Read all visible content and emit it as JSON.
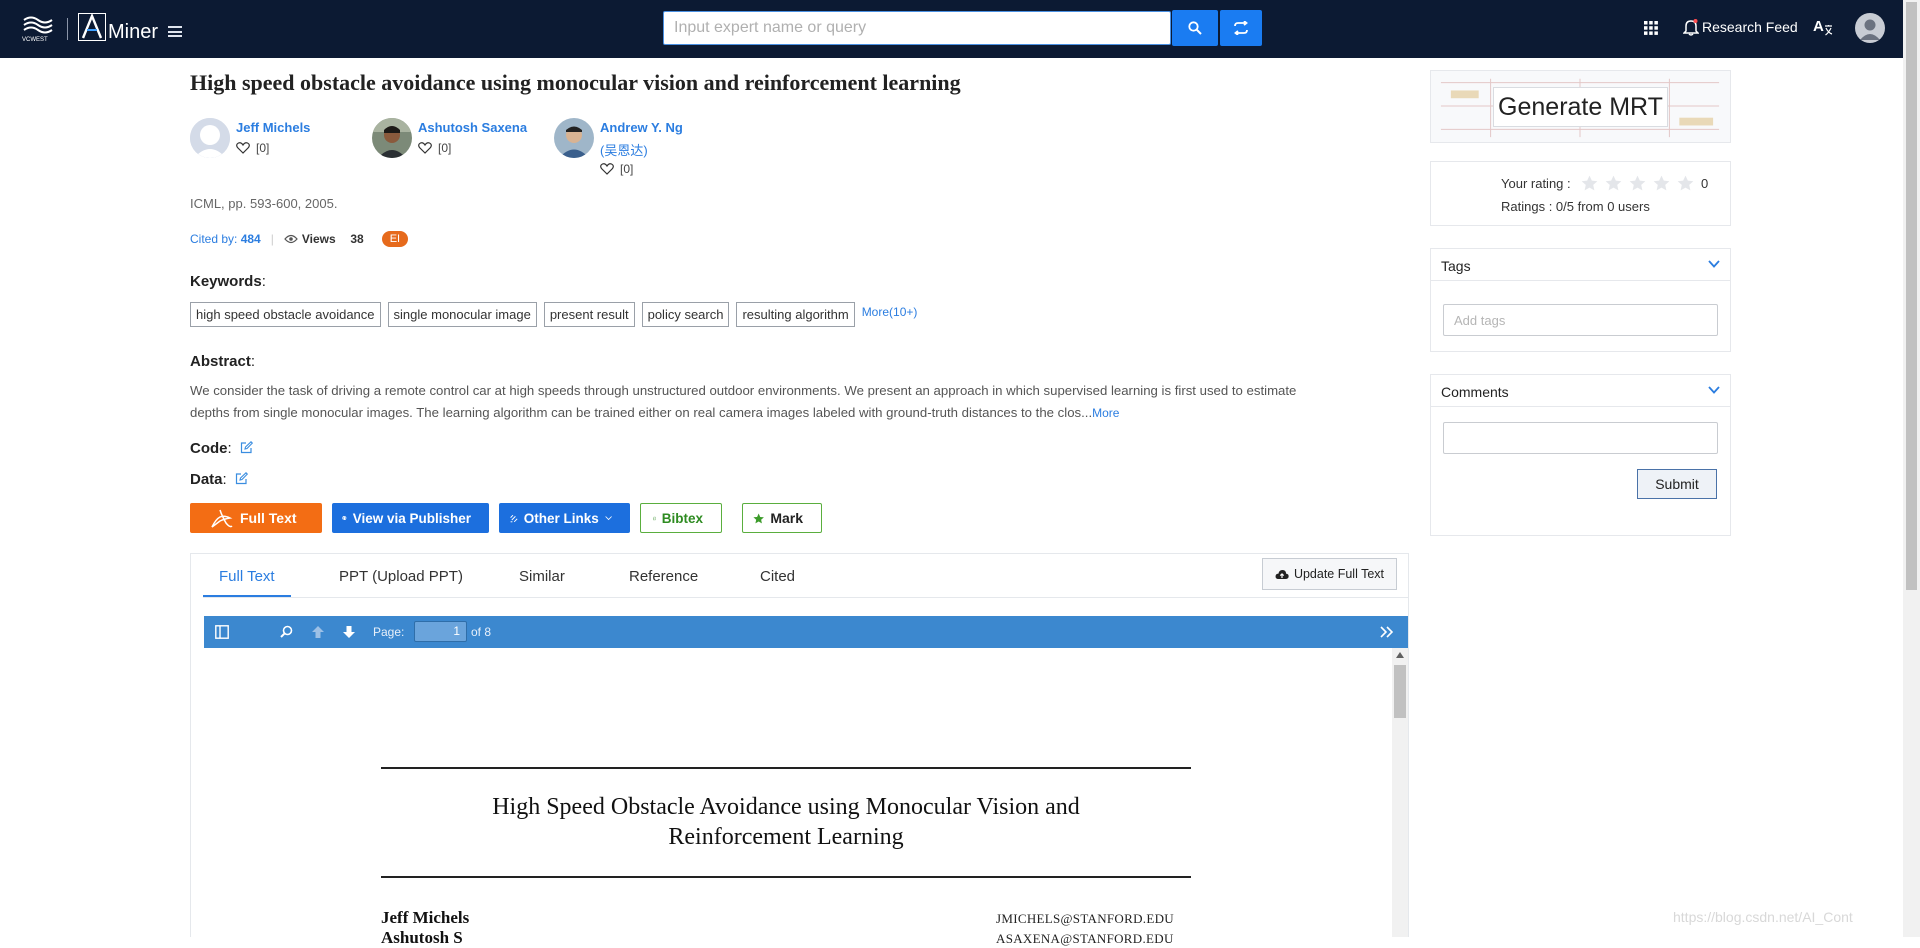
{
  "app": {
    "logo_text": "Miner",
    "research_feed_label": "Research Feed",
    "search_placeholder": "Input expert name or query"
  },
  "paper": {
    "title": "High speed obstacle avoidance using monocular vision and reinforcement learning",
    "venue": "ICML, pp. 593-600, 2005.",
    "cited_by_label": "Cited by:",
    "cited_by_count": "484",
    "views_label": "Views",
    "views_count": "38",
    "index_badge": "EI",
    "authors": [
      {
        "name": "Jeff Michels",
        "follow_count": "[0]"
      },
      {
        "name": "Ashutosh Saxena",
        "follow_count": "[0]"
      },
      {
        "name": "Andrew Y. Ng",
        "alt_name": "(吴恩达)",
        "follow_count": "[0]"
      }
    ],
    "keywords_label": "Keywords",
    "keywords": [
      "high speed obstacle avoidance",
      "single monocular image",
      "present result",
      "policy search",
      "resulting algorithm"
    ],
    "keywords_more": "More(10+)",
    "abstract_label": "Abstract",
    "abstract_line1": "We consider the task of driving a remote control car at high speeds through unstructured outdoor environments. We present an approach in which supervised learning is first used to estimate",
    "abstract_line2": "depths from single monocular images. The learning algorithm can be trained either on real camera images labeled with ground-truth distances to the clos...",
    "abstract_more": "More",
    "code_label": "Code",
    "data_label": "Data"
  },
  "actions": {
    "full_text": "Full Text",
    "view_publisher": "View via Publisher",
    "other_links": "Other Links",
    "bibtex": "Bibtex",
    "mark": "Mark"
  },
  "tabs": [
    {
      "label": "Full Text",
      "active": true
    },
    {
      "label": "PPT (Upload PPT)",
      "active": false
    },
    {
      "label": "Similar",
      "active": false
    },
    {
      "label": "Reference",
      "active": false
    },
    {
      "label": "Cited",
      "active": false
    }
  ],
  "update_full_text": "Update Full Text",
  "pdf_viewer": {
    "page_label": "Page:",
    "current_page": "1",
    "of_label": "of 8",
    "doc_title_line1": "High Speed Obstacle Avoidance using Monocular Vision and",
    "doc_title_line2": "Reinforcement Learning",
    "author1": "Jeff Michels",
    "author2": "Ashutosh S",
    "email1": "JMICHELS@STANFORD.EDU",
    "email2": "ASAXENA@STANFORD.EDU"
  },
  "sidebar": {
    "mrt_label": "Generate MRT",
    "rating_label": "Your rating :",
    "rating_value": "0",
    "rating_stars": 0,
    "rating_summary": "Ratings : 0/5 from 0 users",
    "tags_title": "Tags",
    "tags_placeholder": "Add tags",
    "comments_title": "Comments",
    "submit_label": "Submit"
  },
  "watermark": "https://blog.csdn.net/AI_Cont",
  "colors": {
    "navbar": "#0c1a33",
    "accent_blue": "#1a7cf2",
    "link_blue": "#2b7de0",
    "full_text_orange": "#f36d14",
    "bibtex_green": "#2e8b21",
    "pdf_toolbar": "#3c88cf",
    "ei_badge": "#e66a1c"
  }
}
